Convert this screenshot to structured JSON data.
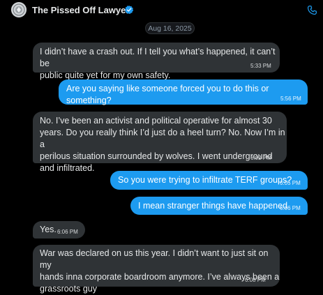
{
  "header": {
    "contact_name": "The Pissed Off Lawyer",
    "verified_icon": "verified-badge-icon",
    "call_icon": "phone-icon",
    "avatar_icon": "profile-avatar"
  },
  "date_separator": "Aug 16, 2025",
  "colors": {
    "background": "#000000",
    "incoming_bubble": "#2f3336",
    "outgoing_bubble": "#1d9bf0",
    "verified": "#1d9bf0"
  },
  "messages": [
    {
      "direction": "incoming",
      "text": "I didn’t have a crash out. If I tell you what’s happened, it can’t be\npublic quite yet for my own safety.",
      "time": "5:33 PM"
    },
    {
      "direction": "outgoing",
      "text": "Are you saying like someone forced you to do this or something?",
      "time": "5:56 PM"
    },
    {
      "direction": "incoming",
      "text": "No. I’ve been an activist and political operative for almost 30\nyears. Do you really think I’d just do a heel turn? No. Now I’m in a\nperilous situation surrounded by wolves. I went underground\nand infiltrated.",
      "time": "6:02 PM"
    },
    {
      "direction": "outgoing",
      "text": "So you were trying to infiltrate TERF groups?",
      "time": "6:05 PM"
    },
    {
      "direction": "outgoing",
      "text": "I mean stranger things have happened",
      "time": "6:06 PM"
    },
    {
      "direction": "incoming",
      "text": "Yes.",
      "time": "6:06 PM"
    },
    {
      "direction": "incoming",
      "text": "War was declared on us this year. I didn’t want to just sit on my\nhands inna corporate boardroom anymore. I’ve always been a\ngrassroots guy",
      "time": "6:08 PM"
    }
  ]
}
